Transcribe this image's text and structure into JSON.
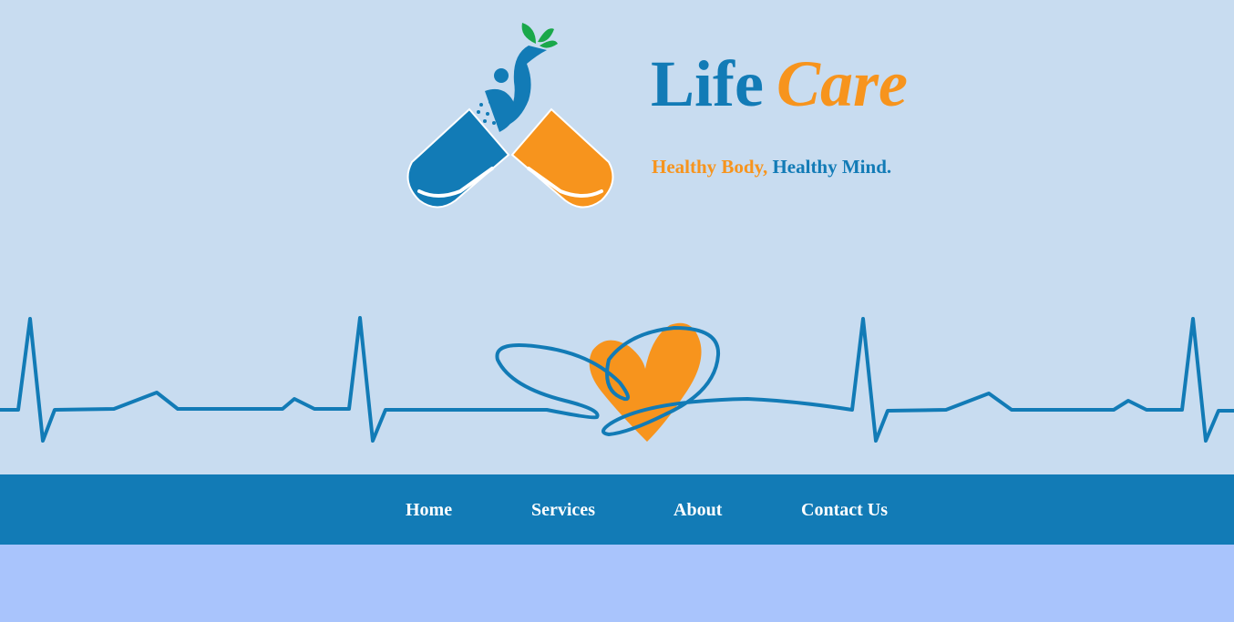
{
  "brand": {
    "name_part1": "Life",
    "name_part2": "Care",
    "tagline_part1": "Healthy Body,",
    "tagline_part2": " Healthy Mind."
  },
  "nav": {
    "items": [
      {
        "label": "Home"
      },
      {
        "label": "Services"
      },
      {
        "label": "About"
      },
      {
        "label": "Contact Us"
      }
    ]
  },
  "colors": {
    "primary_blue": "#127bb6",
    "accent_orange": "#f7941d",
    "leaf_green": "#1aa84a",
    "header_bg": "#c8dcf0",
    "page_bg": "#a9c4fc"
  },
  "icons": {
    "logo": "pill-capsule-with-person-and-leaves-icon",
    "banner": "heartbeat-line-with-heart-icon"
  }
}
